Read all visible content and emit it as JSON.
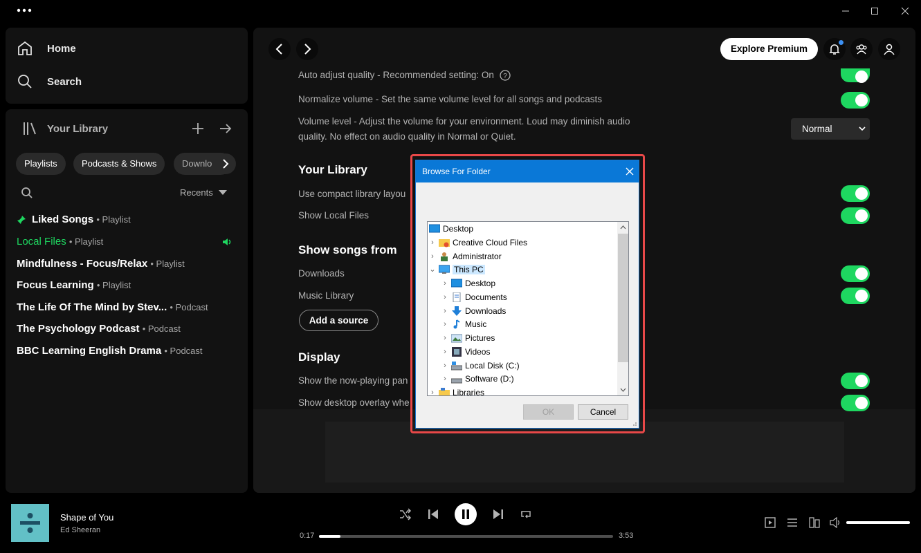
{
  "window": {
    "menu_icon": "more-dots-icon"
  },
  "nav": {
    "home": "Home",
    "search": "Search"
  },
  "library": {
    "title": "Your Library",
    "filters": [
      "Playlists",
      "Podcasts & Shows",
      "Downlo"
    ],
    "sort_label": "Recents",
    "items": [
      {
        "title": "Liked Songs",
        "sub": "• Playlist"
      },
      {
        "title": "Local Files",
        "sub": "• Playlist"
      },
      {
        "title": "Mindfulness - Focus/Relax",
        "sub": "• Playlist"
      },
      {
        "title": "Focus Learning",
        "sub": "• Playlist"
      },
      {
        "title": "The Life Of The Mind by Stev...",
        "sub": "• Podcast"
      },
      {
        "title": "The Psychology Podcast",
        "sub": "• Podcast"
      },
      {
        "title": "BBC Learning English Drama",
        "sub": "• Podcast"
      }
    ],
    "active_color": "#1ed760"
  },
  "header": {
    "explore_premium": "Explore Premium"
  },
  "settings": {
    "auto_adjust": "Auto adjust quality - Recommended setting: On",
    "normalize": "Normalize volume - Set the same volume level for all songs and podcasts",
    "volume_level": "Volume level - Adjust the volume for your environment. Loud may diminish audio quality. No effect on audio quality in Normal or Quiet.",
    "volume_select": "Normal",
    "your_library": "Your Library",
    "compact": "Use compact library layou",
    "show_local": "Show Local Files",
    "show_songs_from": "Show songs from",
    "downloads": "Downloads",
    "music_library": "Music Library",
    "add_source": "Add a source",
    "display": "Display",
    "now_playing": "Show the now-playing pan",
    "overlay": "Show desktop overlay whe"
  },
  "dialog": {
    "title": "Browse For Folder",
    "tree": [
      {
        "label": "Desktop",
        "icon": "desktop-icon"
      },
      {
        "label": "Creative Cloud Files",
        "icon": "creative-cloud-icon"
      },
      {
        "label": "Administrator",
        "icon": "user-folder-icon"
      },
      {
        "label": "This PC",
        "icon": "this-pc-icon"
      },
      {
        "label": "Desktop",
        "icon": "desktop-icon"
      },
      {
        "label": "Documents",
        "icon": "documents-icon"
      },
      {
        "label": "Downloads",
        "icon": "downloads-icon"
      },
      {
        "label": "Music",
        "icon": "music-icon"
      },
      {
        "label": "Pictures",
        "icon": "pictures-icon"
      },
      {
        "label": "Videos",
        "icon": "videos-icon"
      },
      {
        "label": "Local Disk (C:)",
        "icon": "drive-icon"
      },
      {
        "label": "Software (D:)",
        "icon": "drive-icon"
      },
      {
        "label": "Libraries",
        "icon": "libraries-icon"
      }
    ],
    "ok": "OK",
    "cancel": "Cancel"
  },
  "player": {
    "track": "Shape of You",
    "artist": "Ed Sheeran",
    "elapsed": "0:17",
    "duration": "3:53",
    "progress_fraction": 0.073,
    "volume_fraction": 1.0
  }
}
